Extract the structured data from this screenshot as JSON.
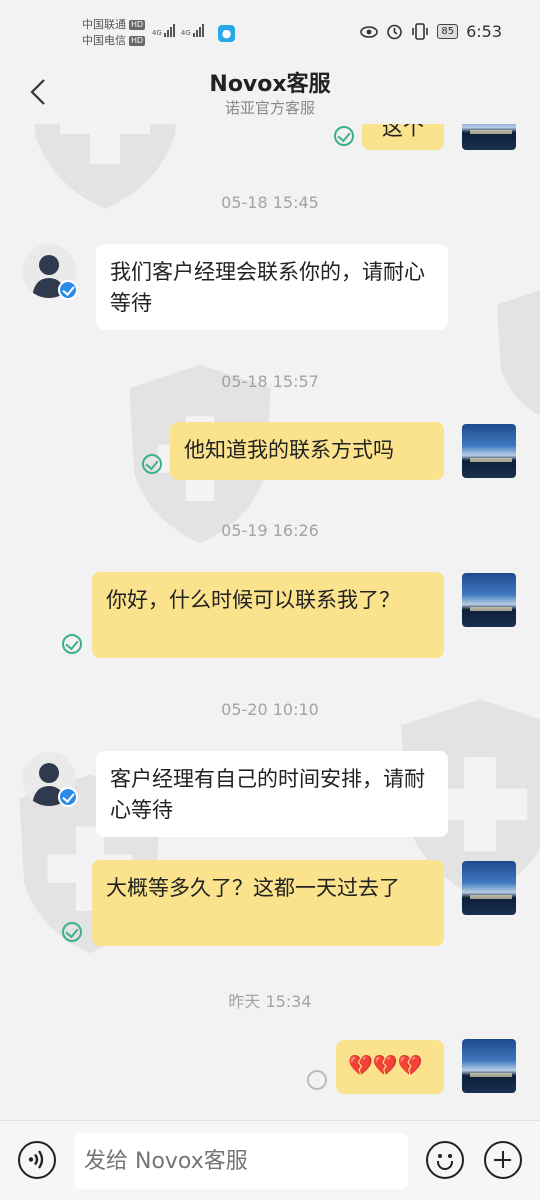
{
  "status": {
    "carrier1": "中国联通",
    "carrier2": "中国电信",
    "hd": "HD",
    "net": "4G",
    "battery": "85",
    "time": "6:53"
  },
  "header": {
    "title": "Novox客服",
    "subtitle": "诺亚官方客服"
  },
  "messages": {
    "m0": "这个",
    "t1": "05-18 15:45",
    "m1": "我们客户经理会联系你的，请耐心等待",
    "t2": "05-18 15:57",
    "m2": "他知道我的联系方式吗",
    "t3": "05-19 16:26",
    "m3": "你好，什么时候可以联系我了？",
    "t4": "05-20 10:10",
    "m4": "客户经理有自己的时间安排，请耐心等待",
    "m5": "大概等多久了？这都一天过去了",
    "t5": "昨天 15:34",
    "m6": "💔💔💔"
  },
  "input": {
    "placeholder": "发给 Novox客服"
  },
  "colors": {
    "outgoing_bubble": "#fbe28c",
    "incoming_bubble": "#ffffff",
    "read_check": "#3bb08a",
    "verified_badge": "#2c8be8"
  }
}
